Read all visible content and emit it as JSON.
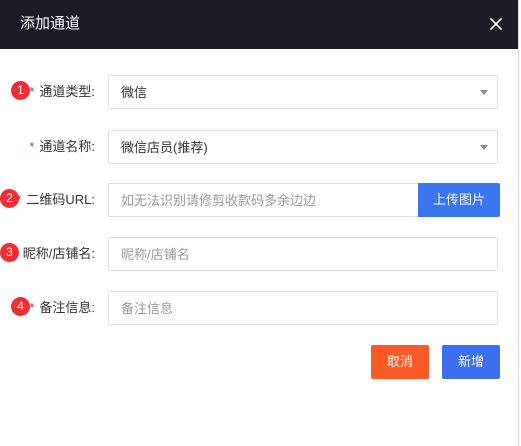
{
  "dialog": {
    "title": "添加通道",
    "close_icon": "close-icon"
  },
  "fields": {
    "channel_type": {
      "badge": "1",
      "required": "*",
      "label": "通道类型:",
      "value": "微信"
    },
    "channel_name": {
      "required": "*",
      "label": "通道名称:",
      "value": "微信店员(推荐)"
    },
    "qrcode_url": {
      "badge": "2",
      "required": "*",
      "label": "二维码URL:",
      "placeholder": "如无法识别请修剪收款码多余边边",
      "upload_label": "上传图片"
    },
    "nickname": {
      "badge": "3",
      "required": "*",
      "label": "昵称/店铺名:",
      "placeholder": "昵称/店铺名"
    },
    "remark": {
      "badge": "4",
      "required": "*",
      "label": "备注信息:",
      "placeholder": "备注信息"
    }
  },
  "actions": {
    "cancel_label": "取消",
    "add_label": "新增"
  },
  "colors": {
    "header_bg": "#1c1c28",
    "badge": "#ee2e34",
    "primary": "#3b76f0",
    "cancel": "#fb5a26",
    "required": "#f5222d"
  }
}
